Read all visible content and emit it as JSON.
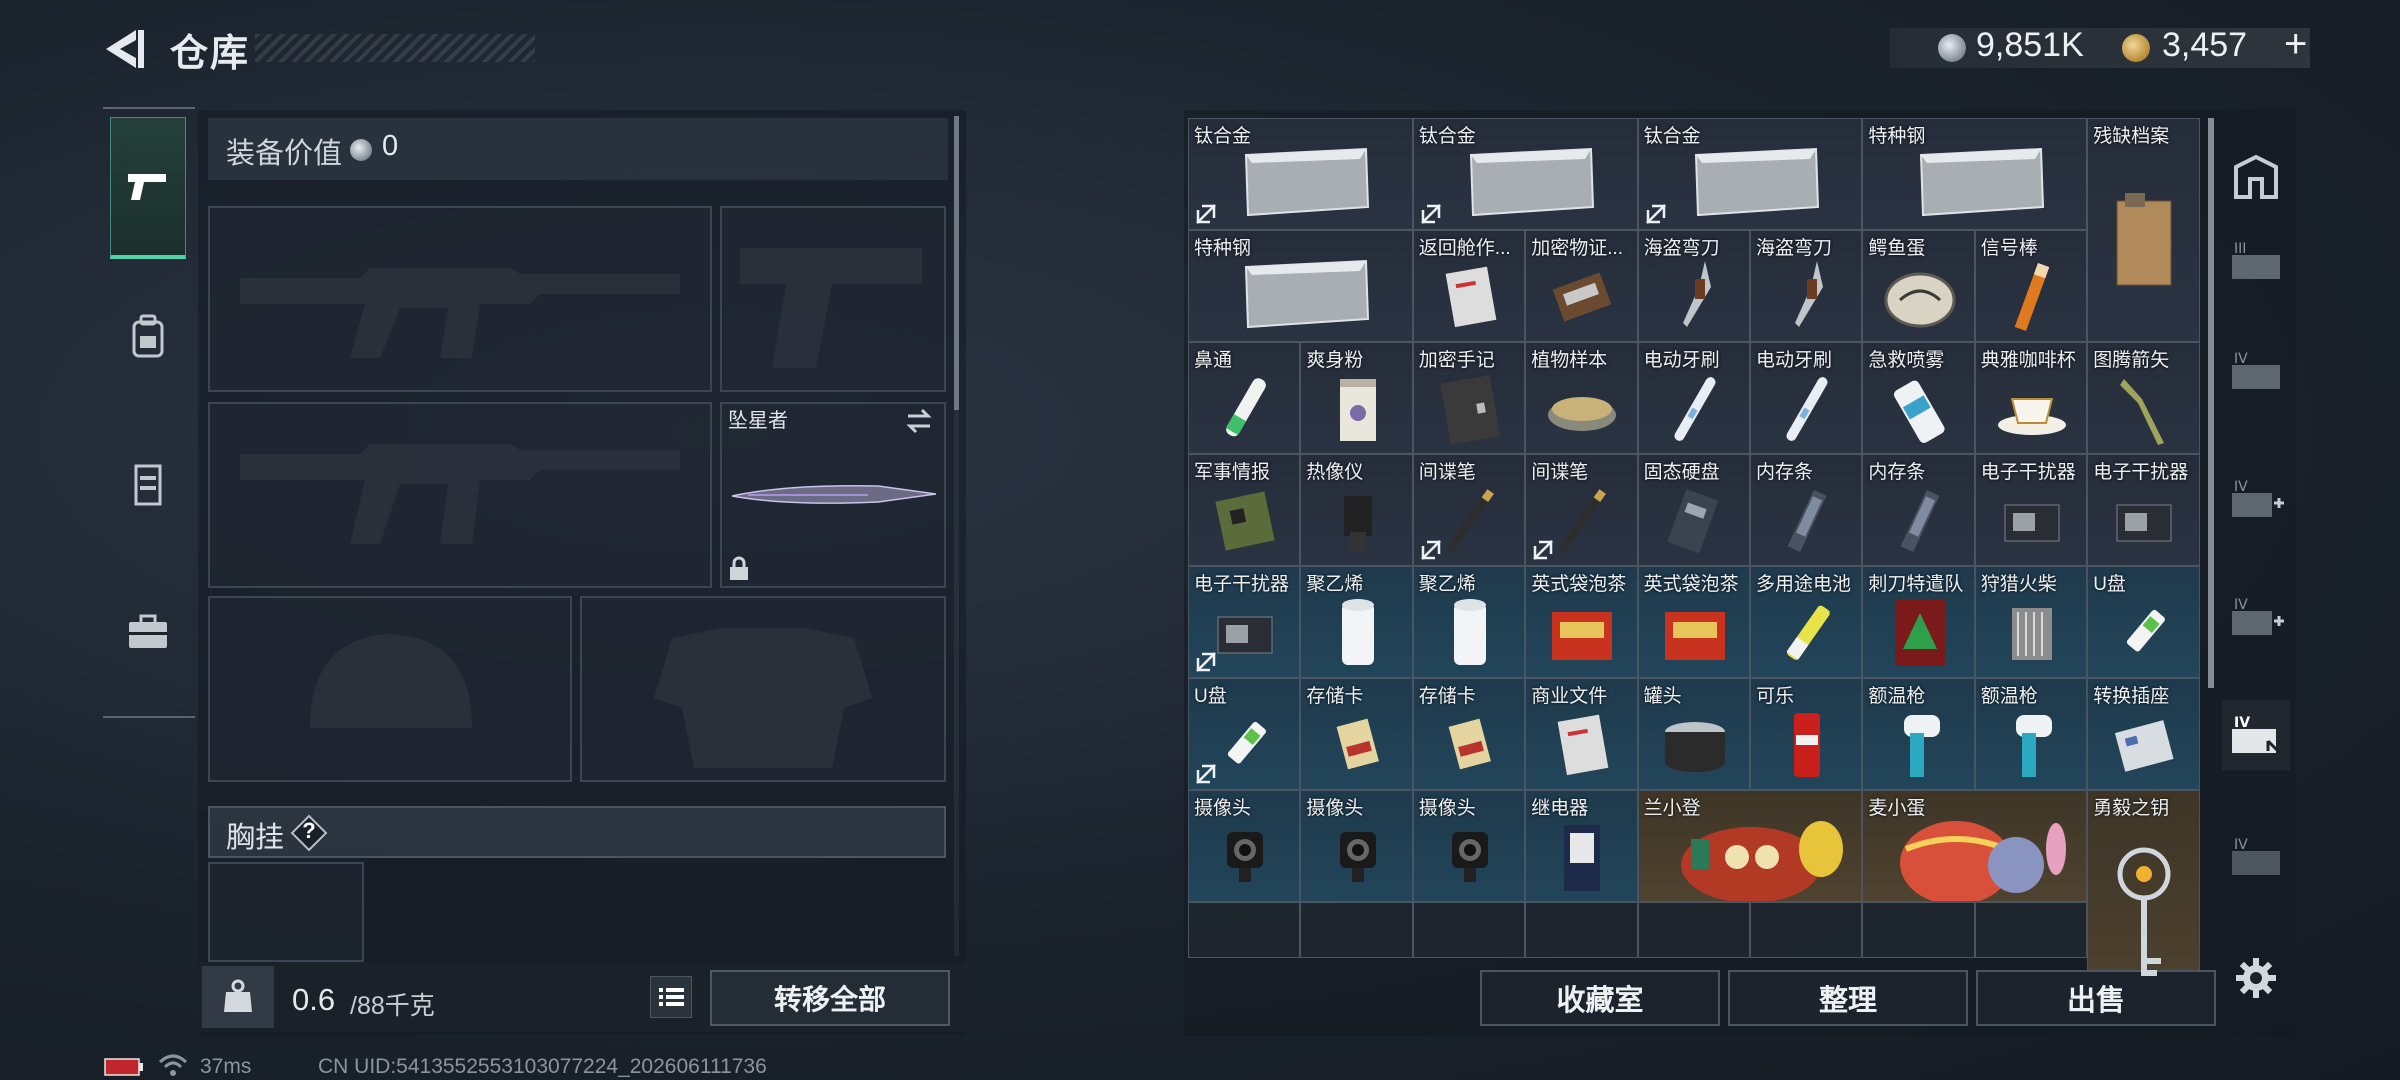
{
  "header": {
    "title": "仓库"
  },
  "currency": {
    "silver": "9,851K",
    "gold": "3,457",
    "plus": "+"
  },
  "gear": {
    "value_label": "装备价值",
    "value": "0",
    "melee_name": "坠星者",
    "chest_rig_label": "胸挂",
    "chest_rig_help": "?"
  },
  "weight": {
    "current": "0.6",
    "max": "/88千克"
  },
  "buttons": {
    "transfer_all": "转移全部",
    "collection": "收藏室",
    "organize": "整理",
    "sell": "出售"
  },
  "status": {
    "ping": "37ms",
    "uid": "CN UID:5413552553103077224_202606111736"
  },
  "colors": {
    "accent": "#4fd3a6",
    "gold_cell": "#4f4330",
    "blue_cell": "#22455a"
  },
  "storage_items": [
    {
      "label": "钛合金",
      "art": "ingot",
      "nosell": true
    },
    {
      "label": "钛合金",
      "art": "ingot",
      "nosell": true
    },
    {
      "label": "钛合金",
      "art": "ingot",
      "nosell": true
    },
    {
      "label": "特种钢",
      "art": "ingot",
      "nosell": false
    },
    {
      "label": "残缺档案",
      "art": "file",
      "nosell": false
    },
    {
      "label": "特种钢",
      "art": "ingot",
      "nosell": false
    },
    {
      "label": "返回舱作...",
      "art": "paper",
      "nosell": false
    },
    {
      "label": "加密物证...",
      "art": "tape",
      "nosell": false
    },
    {
      "label": "海盗弯刀",
      "art": "knife",
      "nosell": false
    },
    {
      "label": "海盗弯刀",
      "art": "knife",
      "nosell": false
    },
    {
      "label": "鳄鱼蛋",
      "art": "egg",
      "nosell": false
    },
    {
      "label": "信号棒",
      "art": "flare",
      "nosell": false
    },
    {
      "label": "鼻通",
      "art": "tube",
      "nosell": false
    },
    {
      "label": "爽身粉",
      "art": "can",
      "nosell": false
    },
    {
      "label": "加密手记",
      "art": "notebook",
      "nosell": false
    },
    {
      "label": "植物样本",
      "art": "dish",
      "nosell": false
    },
    {
      "label": "电动牙刷",
      "art": "toothbrush",
      "nosell": false
    },
    {
      "label": "电动牙刷",
      "art": "toothbrush",
      "nosell": false
    },
    {
      "label": "急救喷雾",
      "art": "spray",
      "nosell": false
    },
    {
      "label": "典雅咖啡杯",
      "art": "cup",
      "nosell": false
    },
    {
      "label": "图腾箭矢",
      "art": "arrow",
      "nosell": false
    },
    {
      "label": "军事情报",
      "art": "board",
      "nosell": false
    },
    {
      "label": "热像仪",
      "art": "device",
      "nosell": false
    },
    {
      "label": "间谍笔",
      "art": "pen",
      "nosell": true
    },
    {
      "label": "间谍笔",
      "art": "pen",
      "nosell": true
    },
    {
      "label": "固态硬盘",
      "art": "ssd",
      "nosell": false
    },
    {
      "label": "内存条",
      "art": "ram",
      "nosell": false
    },
    {
      "label": "内存条",
      "art": "ram",
      "nosell": false
    },
    {
      "label": "电子干扰器",
      "art": "jammer",
      "nosell": false
    },
    {
      "label": "电子干扰器",
      "art": "jammer",
      "nosell": false
    },
    {
      "label": "电子干扰器",
      "art": "jammer",
      "nosell": true
    },
    {
      "label": "聚乙烯",
      "art": "roll",
      "nosell": false
    },
    {
      "label": "聚乙烯",
      "art": "roll",
      "nosell": false
    },
    {
      "label": "英式袋泡茶",
      "art": "teabox",
      "nosell": false
    },
    {
      "label": "英式袋泡茶",
      "art": "teabox",
      "nosell": false
    },
    {
      "label": "多用途电池",
      "art": "battery",
      "nosell": false
    },
    {
      "label": "刺刀特遣队",
      "art": "game",
      "nosell": false
    },
    {
      "label": "狩猎火柴",
      "art": "matches",
      "nosell": false
    },
    {
      "label": "U盘",
      "art": "usb",
      "nosell": false
    },
    {
      "label": "U盘",
      "art": "usb",
      "nosell": true
    },
    {
      "label": "存储卡",
      "art": "sdcard",
      "nosell": false
    },
    {
      "label": "存储卡",
      "art": "sdcard",
      "nosell": false
    },
    {
      "label": "商业文件",
      "art": "paper",
      "nosell": false
    },
    {
      "label": "罐头",
      "art": "tin",
      "nosell": false
    },
    {
      "label": "可乐",
      "art": "cola",
      "nosell": false
    },
    {
      "label": "额温枪",
      "art": "thermo",
      "nosell": false
    },
    {
      "label": "额温枪",
      "art": "thermo",
      "nosell": false
    },
    {
      "label": "转换插座",
      "art": "socket",
      "nosell": false
    },
    {
      "label": "摄像头",
      "art": "camera",
      "nosell": false
    },
    {
      "label": "摄像头",
      "art": "camera",
      "nosell": false
    },
    {
      "label": "摄像头",
      "art": "camera",
      "nosell": false
    },
    {
      "label": "继电器",
      "art": "relay",
      "nosell": false
    },
    {
      "label": "兰小登",
      "art": "figure",
      "nosell": false
    },
    {
      "label": "麦小蛋",
      "art": "figure2",
      "nosell": false
    },
    {
      "label": "勇毅之钥",
      "art": "key",
      "nosell": false
    }
  ]
}
